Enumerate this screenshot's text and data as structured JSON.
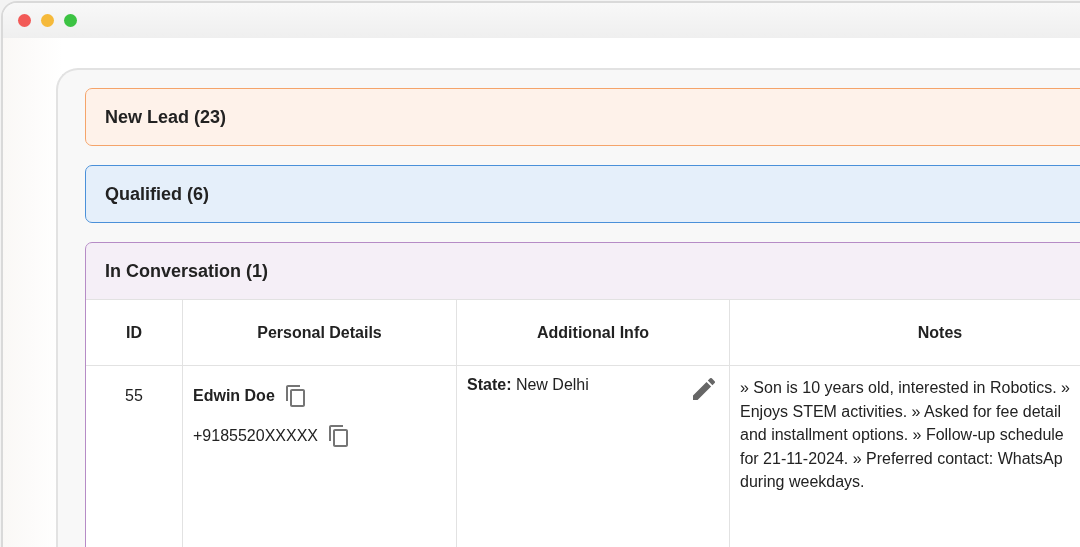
{
  "sections": [
    {
      "title": "New Lead (23)",
      "color": "#f5a46a"
    },
    {
      "title": "Qualified (6)",
      "color": "#4a90d9"
    },
    {
      "title": "In Conversation (1)",
      "color": "#b68cc6",
      "table": {
        "columns": [
          "ID",
          "Personal Details",
          "Additional Info",
          "Notes"
        ],
        "rows": [
          {
            "id": "55",
            "name": "Edwin Doe",
            "phone": "+9185520XXXXX",
            "info": "**State:** New Delhi",
            "notes": [
              "» Son is 10 years old, interested in Robotics. »",
              "Enjoys STEM activities. » Asked for fee detail",
              "and installment options. » Follow-up schedule",
              "for 21-11-2024. » Preferred contact: WhatsAp",
              "during weekdays."
            ]
          }
        ]
      }
    }
  ]
}
